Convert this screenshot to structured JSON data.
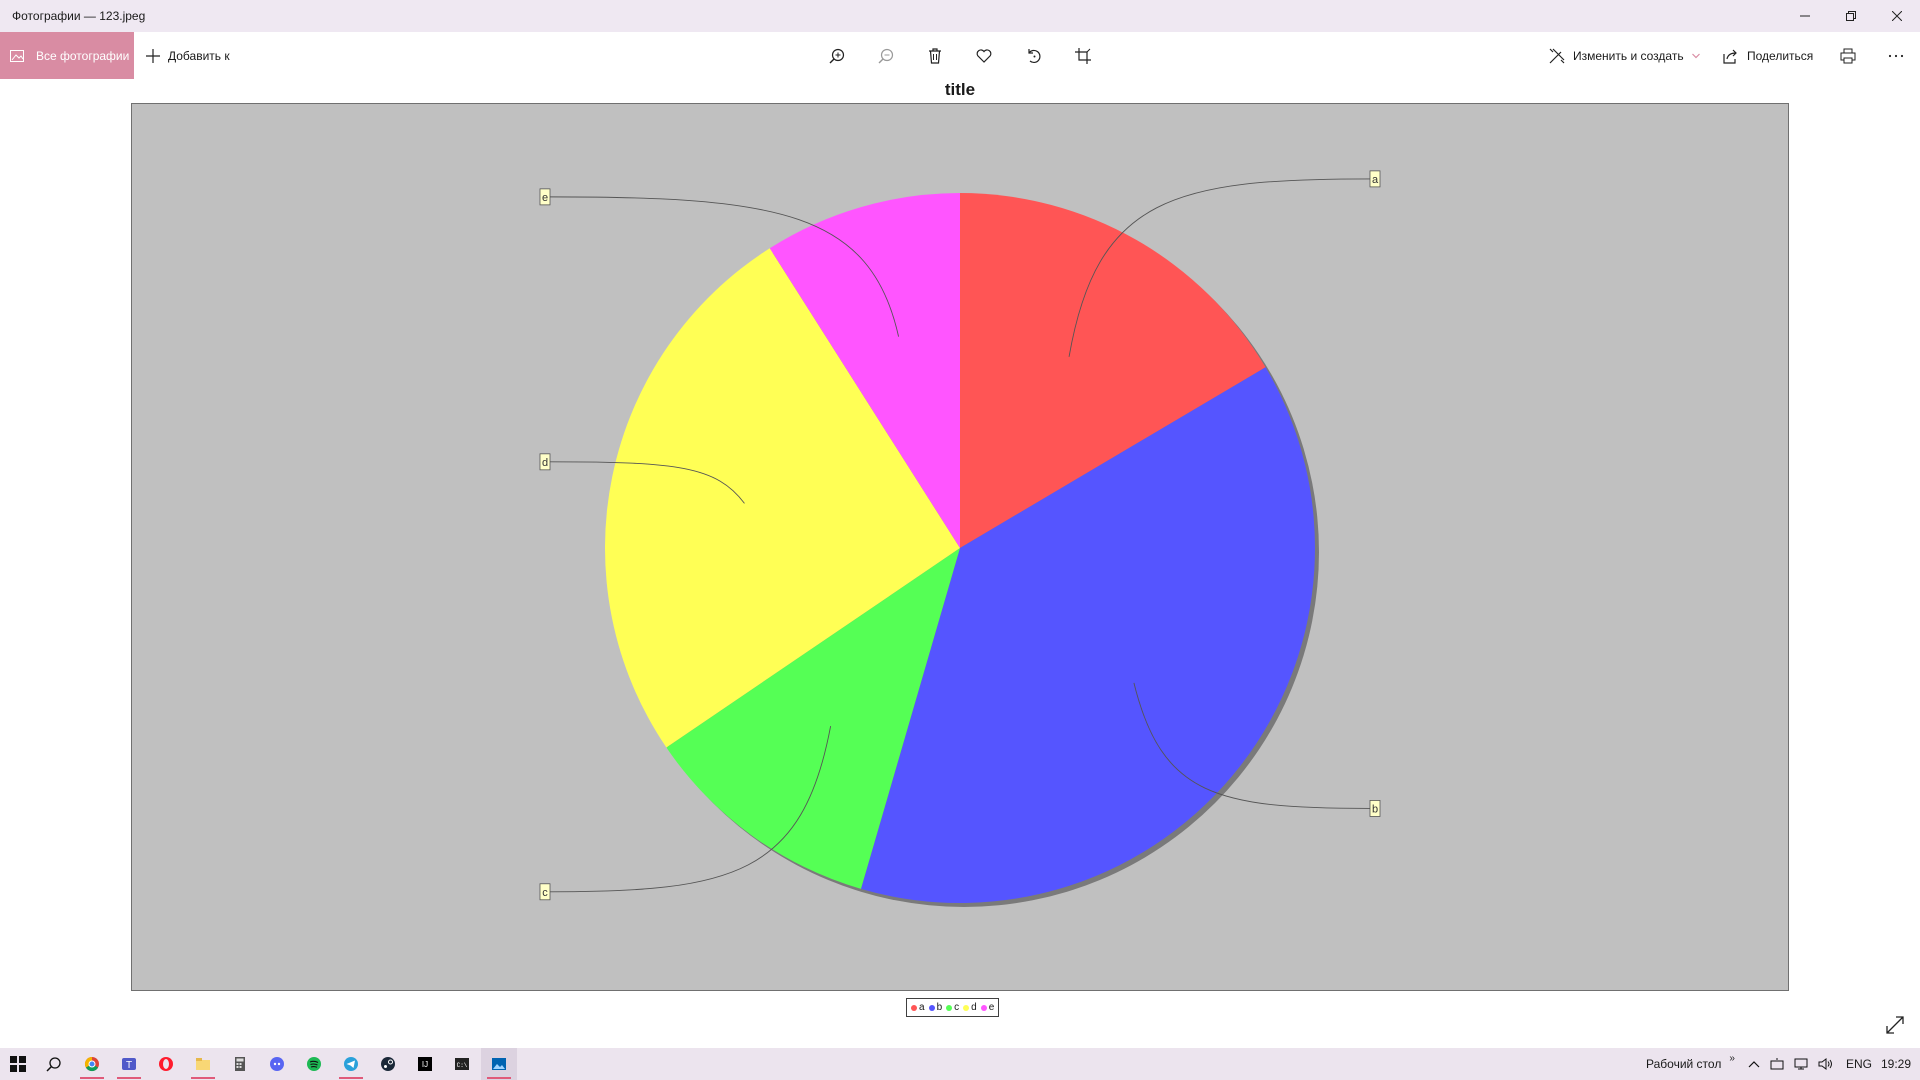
{
  "window": {
    "title": "Фотографии — 123.jpeg"
  },
  "toolbar": {
    "all_photos_label": "Все фотографии",
    "add_to_label": "Добавить к",
    "edit_create_label": "Изменить и создать",
    "share_label": "Поделиться"
  },
  "chart_data": {
    "type": "pie",
    "title": "title",
    "categories": [
      "a",
      "b",
      "c",
      "d",
      "e"
    ],
    "values": [
      16.5,
      38,
      11,
      25.5,
      9
    ],
    "colors": [
      "#ff5555",
      "#5555ff",
      "#55ff55",
      "#ffff55",
      "#ff55ff"
    ],
    "legend": "bottom"
  },
  "taskbar": {
    "desktop_label": "Рабочий стол",
    "desktop_chevron": "»",
    "lang": "ENG",
    "time": "19:29",
    "apps": [
      "chrome-icon",
      "teams-icon",
      "opera-icon",
      "explorer-icon",
      "calculator-icon",
      "discord-icon",
      "spotify-icon",
      "telegram-icon",
      "steam-icon",
      "intellij-icon",
      "terminal-icon",
      "photos-icon"
    ]
  }
}
